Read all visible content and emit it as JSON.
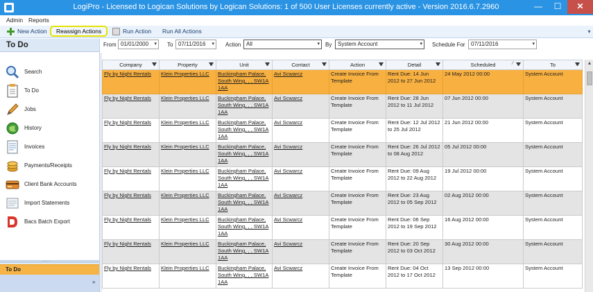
{
  "window": {
    "title": "LogiPro - Licensed to Logican Solutions by Logican Solutions: 1 of 500 User Licenses currently active - Version 2016.6.7.2960",
    "minimize": "—",
    "maximize": "☐",
    "close": "✕"
  },
  "menu": {
    "items": [
      "Admin",
      "Reports"
    ]
  },
  "toolbar": {
    "new_action": "New Action",
    "reassign_actions": "Reassign Actions",
    "run_action": "Run Action",
    "run_all_actions": "Run All Actions",
    "highlight_color": "#e3e200"
  },
  "sidebar": {
    "header": "To Do",
    "items": [
      {
        "label": "Search",
        "icon": "search-icon"
      },
      {
        "label": "To Do",
        "icon": "todo-icon"
      },
      {
        "label": "Jobs",
        "icon": "jobs-icon"
      },
      {
        "label": "History",
        "icon": "history-icon"
      },
      {
        "label": "Invoices",
        "icon": "invoices-icon"
      },
      {
        "label": "Payments/Receipts",
        "icon": "payments-icon"
      },
      {
        "label": "Client Bank Accounts",
        "icon": "bank-card-icon"
      },
      {
        "label": "Import Statements",
        "icon": "import-icon"
      },
      {
        "label": "Bacs Batch Export",
        "icon": "bacs-icon"
      }
    ],
    "footer_active": "To Do",
    "expand": "»"
  },
  "filters": {
    "from_label": "From",
    "from_value": "01/01/2000",
    "to_label": "To",
    "to_value": "07/11/2016",
    "action_label": "Action",
    "action_value": "All",
    "by_label": "By",
    "by_value": "System Account",
    "schedule_label": "Schedule For",
    "schedule_value": "07/11/2016"
  },
  "grid": {
    "columns": [
      "Company",
      "Property",
      "Unit",
      "Contact",
      "Action",
      "Detail",
      "Scheduled",
      "To"
    ],
    "rows": [
      {
        "company": "Fly by Night Rentals",
        "property": "Klein Properties LLC",
        "unit": "Buckingham Palace, South Wing, , , SW1A 1AA",
        "contact": "Avi Scwarcz",
        "action": "Create Invoice From Template",
        "detail": "Rent Due: 14 Jun 2012 to 27 Jun 2012",
        "scheduled": "24 May 2012 00:00",
        "to": "System Account"
      },
      {
        "company": "Fly by Night Rentals",
        "property": "Klein Properties LLC",
        "unit": "Buckingham Palace, South Wing, , , SW1A 1AA",
        "contact": "Avi Scwarcz",
        "action": "Create Invoice From Template",
        "detail": "Rent Due: 28 Jun 2012 to 11 Jul 2012",
        "scheduled": "07 Jun 2012 00:00",
        "to": "System Account"
      },
      {
        "company": "Fly by Night Rentals",
        "property": "Klein Properties LLC",
        "unit": "Buckingham Palace, South Wing, , , SW1A 1AA",
        "contact": "Avi Scwarcz",
        "action": "Create Invoice From Template",
        "detail": "Rent Due: 12 Jul 2012 to 25 Jul 2012",
        "scheduled": "21 Jun 2012 00:00",
        "to": "System Account"
      },
      {
        "company": "Fly by Night Rentals",
        "property": "Klein Properties LLC",
        "unit": "Buckingham Palace, South Wing, , , SW1A 1AA",
        "contact": "Avi Scwarcz",
        "action": "Create Invoice From Template",
        "detail": "Rent Due: 26 Jul 2012 to 08 Aug 2012",
        "scheduled": "05 Jul 2012 00:00",
        "to": "System Account"
      },
      {
        "company": "Fly by Night Rentals",
        "property": "Klein Properties LLC",
        "unit": "Buckingham Palace, South Wing, , , SW1A 1AA",
        "contact": "Avi Scwarcz",
        "action": "Create Invoice From Template",
        "detail": "Rent Due: 09 Aug 2012 to 22 Aug 2012",
        "scheduled": "19 Jul 2012 00:00",
        "to": "System Account"
      },
      {
        "company": "Fly by Night Rentals",
        "property": "Klein Properties LLC",
        "unit": "Buckingham Palace, South Wing, , , SW1A 1AA",
        "contact": "Avi Scwarcz",
        "action": "Create Invoice From Template",
        "detail": "Rent Due: 23 Aug 2012 to 05 Sep 2012",
        "scheduled": "02 Aug 2012 00:00",
        "to": "System Account"
      },
      {
        "company": "Fly by Night Rentals",
        "property": "Klein Properties LLC",
        "unit": "Buckingham Palace, South Wing, , , SW1A 1AA",
        "contact": "Avi Scwarcz",
        "action": "Create Invoice From Template",
        "detail": "Rent Due: 06 Sep 2012 to 19 Sep 2012",
        "scheduled": "16 Aug 2012 00:00",
        "to": "System Account"
      },
      {
        "company": "Fly by Night Rentals",
        "property": "Klein Properties LLC",
        "unit": "Buckingham Palace, South Wing, , , SW1A 1AA",
        "contact": "Avi Scwarcz",
        "action": "Create Invoice From Template",
        "detail": "Rent Due: 20 Sep 2012 to 03 Oct 2012",
        "scheduled": "30 Aug 2012 00:00",
        "to": "System Account"
      },
      {
        "company": "Fly by Night Rentals",
        "property": "Klein Properties LLC",
        "unit": "Buckingham Palace, South Wing, , , SW1A 1AA",
        "contact": "Avi Scwarcz",
        "action": "Create Invoice From Template",
        "detail": "Rent Due: 04 Oct 2012 to 17 Oct 2012",
        "scheduled": "13 Sep 2012 00:00",
        "to": "System Account"
      }
    ],
    "selected_row_color": "#f8b040"
  }
}
